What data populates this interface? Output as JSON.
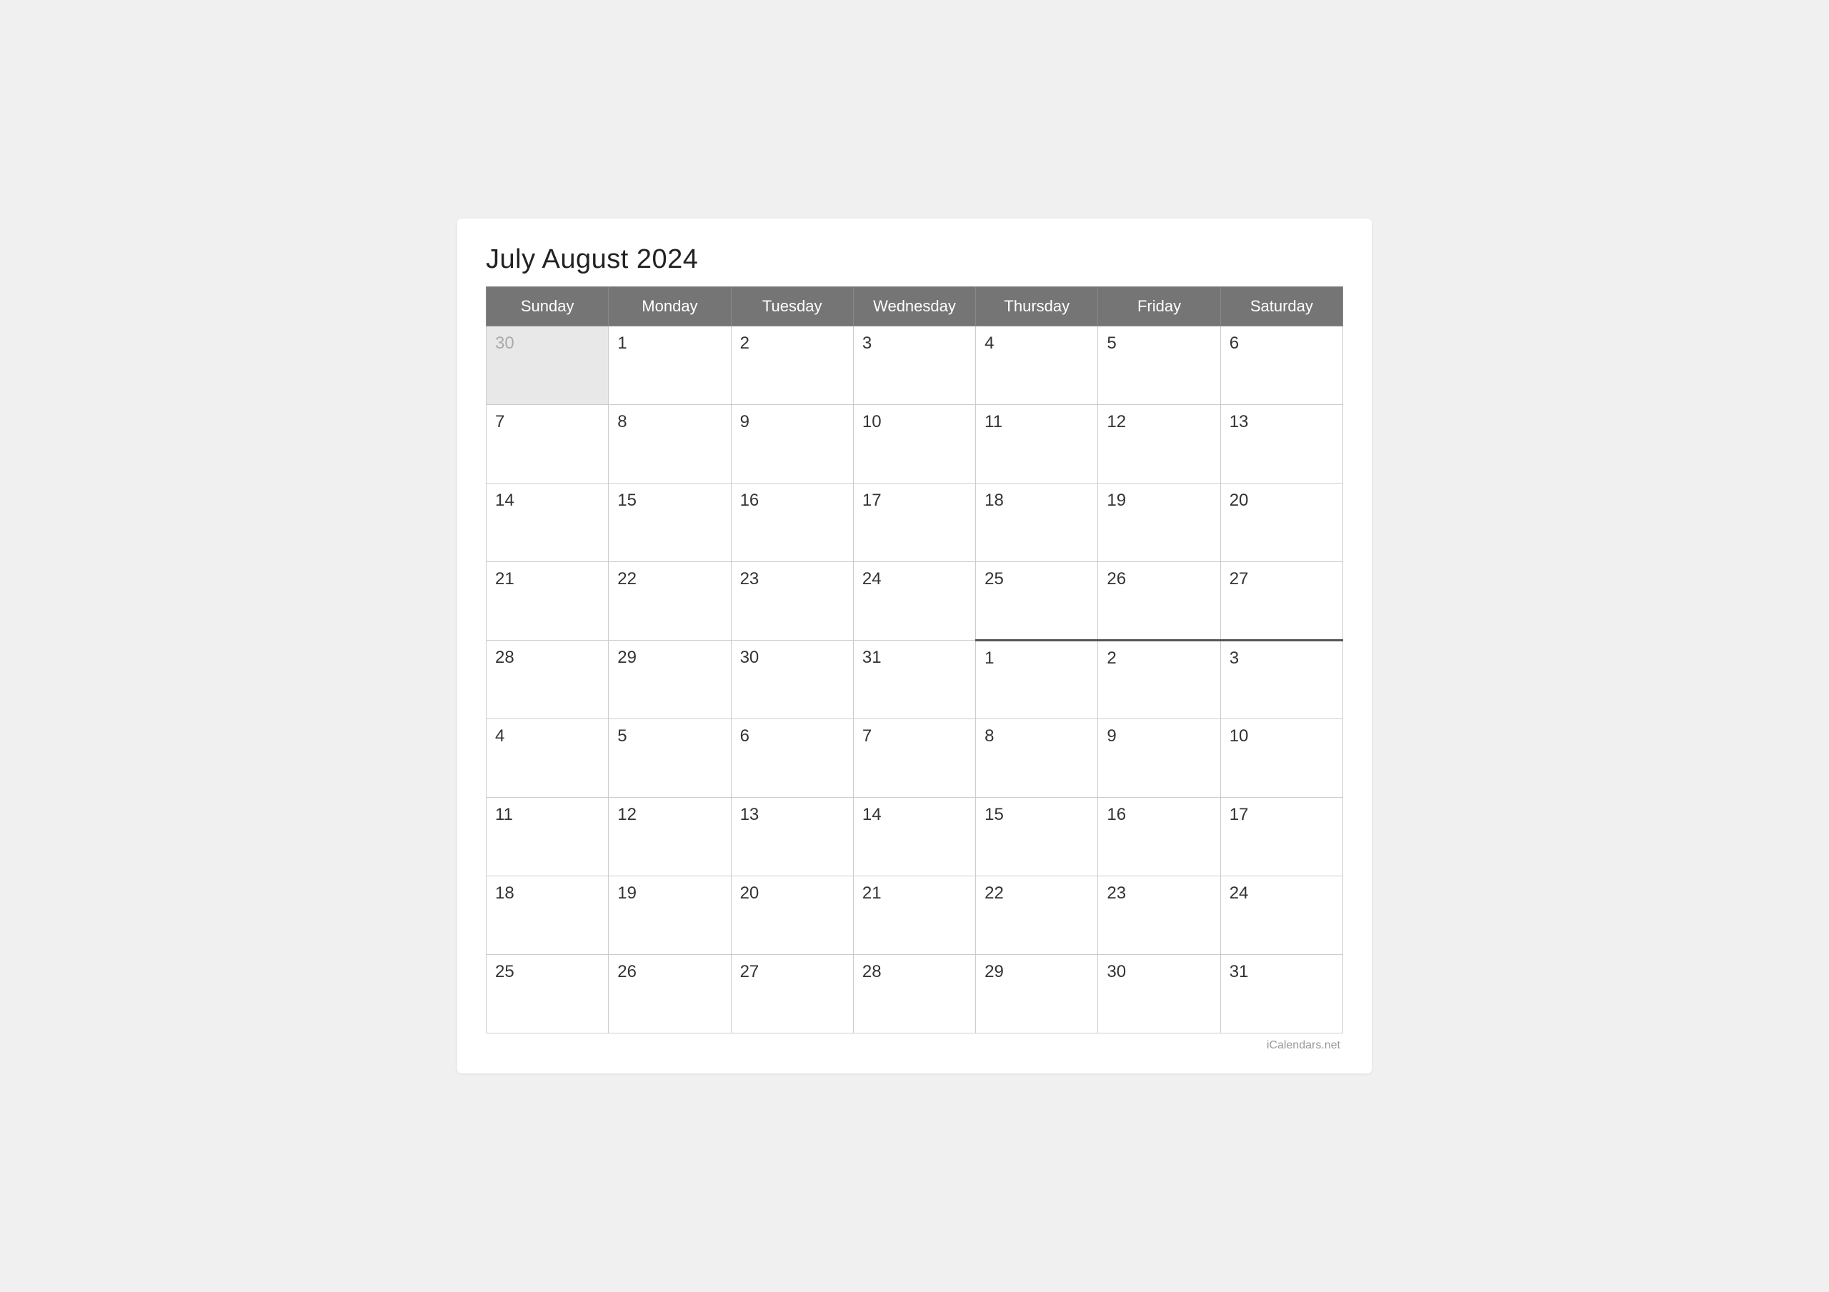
{
  "title": "July August 2024",
  "watermark": "iCalendars.net",
  "headers": [
    "Sunday",
    "Monday",
    "Tuesday",
    "Wednesday",
    "Thursday",
    "Friday",
    "Saturday"
  ],
  "weeks": [
    {
      "days": [
        {
          "num": "30",
          "type": "prev-month"
        },
        {
          "num": "1",
          "type": "current"
        },
        {
          "num": "2",
          "type": "current"
        },
        {
          "num": "3",
          "type": "current"
        },
        {
          "num": "4",
          "type": "current"
        },
        {
          "num": "5",
          "type": "current"
        },
        {
          "num": "6",
          "type": "current"
        }
      ]
    },
    {
      "days": [
        {
          "num": "7",
          "type": "current"
        },
        {
          "num": "8",
          "type": "current"
        },
        {
          "num": "9",
          "type": "current"
        },
        {
          "num": "10",
          "type": "current"
        },
        {
          "num": "11",
          "type": "current"
        },
        {
          "num": "12",
          "type": "current"
        },
        {
          "num": "13",
          "type": "current"
        }
      ]
    },
    {
      "days": [
        {
          "num": "14",
          "type": "current"
        },
        {
          "num": "15",
          "type": "current"
        },
        {
          "num": "16",
          "type": "current"
        },
        {
          "num": "17",
          "type": "current"
        },
        {
          "num": "18",
          "type": "current"
        },
        {
          "num": "19",
          "type": "current"
        },
        {
          "num": "20",
          "type": "current"
        }
      ]
    },
    {
      "days": [
        {
          "num": "21",
          "type": "current"
        },
        {
          "num": "22",
          "type": "current"
        },
        {
          "num": "23",
          "type": "current"
        },
        {
          "num": "24",
          "type": "current"
        },
        {
          "num": "25",
          "type": "current"
        },
        {
          "num": "26",
          "type": "current"
        },
        {
          "num": "27",
          "type": "current"
        }
      ]
    },
    {
      "days": [
        {
          "num": "28",
          "type": "current"
        },
        {
          "num": "29",
          "type": "current"
        },
        {
          "num": "30",
          "type": "current"
        },
        {
          "num": "31",
          "type": "current"
        },
        {
          "num": "1",
          "type": "august-start"
        },
        {
          "num": "2",
          "type": "august-start"
        },
        {
          "num": "3",
          "type": "august-start"
        }
      ]
    },
    {
      "days": [
        {
          "num": "4",
          "type": "next-month"
        },
        {
          "num": "5",
          "type": "next-month"
        },
        {
          "num": "6",
          "type": "next-month"
        },
        {
          "num": "7",
          "type": "next-month"
        },
        {
          "num": "8",
          "type": "next-month"
        },
        {
          "num": "9",
          "type": "next-month"
        },
        {
          "num": "10",
          "type": "next-month"
        }
      ]
    },
    {
      "days": [
        {
          "num": "11",
          "type": "next-month"
        },
        {
          "num": "12",
          "type": "next-month"
        },
        {
          "num": "13",
          "type": "next-month"
        },
        {
          "num": "14",
          "type": "next-month"
        },
        {
          "num": "15",
          "type": "next-month"
        },
        {
          "num": "16",
          "type": "next-month"
        },
        {
          "num": "17",
          "type": "next-month"
        }
      ]
    },
    {
      "days": [
        {
          "num": "18",
          "type": "next-month"
        },
        {
          "num": "19",
          "type": "next-month"
        },
        {
          "num": "20",
          "type": "next-month"
        },
        {
          "num": "21",
          "type": "next-month"
        },
        {
          "num": "22",
          "type": "next-month"
        },
        {
          "num": "23",
          "type": "next-month"
        },
        {
          "num": "24",
          "type": "next-month"
        }
      ]
    },
    {
      "days": [
        {
          "num": "25",
          "type": "next-month"
        },
        {
          "num": "26",
          "type": "next-month"
        },
        {
          "num": "27",
          "type": "next-month"
        },
        {
          "num": "28",
          "type": "next-month"
        },
        {
          "num": "29",
          "type": "next-month"
        },
        {
          "num": "30",
          "type": "next-month"
        },
        {
          "num": "31",
          "type": "next-month"
        }
      ]
    }
  ]
}
